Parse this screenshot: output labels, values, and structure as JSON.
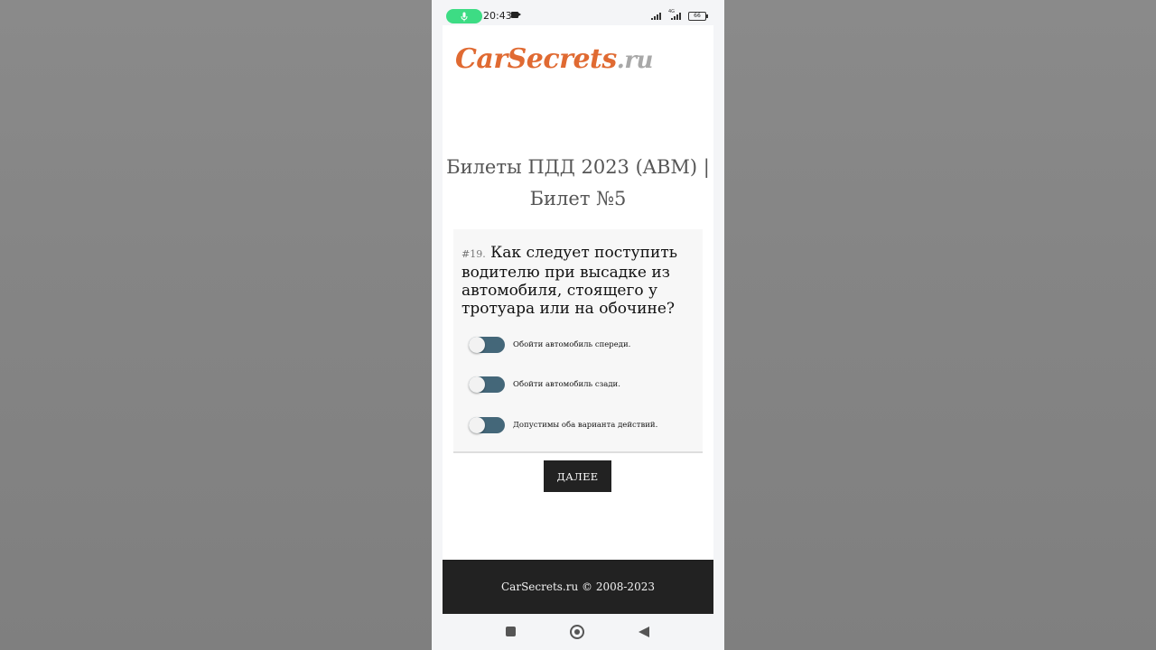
{
  "status_bar": {
    "time": "20:43",
    "network": "4G",
    "battery": "66"
  },
  "site": {
    "logo_main": "CarSecrets",
    "logo_tld": ".ru",
    "title_line1": "Билеты ПДД 2023 (ABM) |",
    "title_line2": "Билет №5"
  },
  "quiz": {
    "question_number": "#19.",
    "question_text": "Как следует поступить водителю при высадке из автомобиля, стоящего у тротуара или на обочине?",
    "options": [
      {
        "label": "Обойти автомобиль спереди.",
        "selected": false
      },
      {
        "label": "Обойти автомобиль сзади.",
        "selected": false
      },
      {
        "label": "Допустимы оба варианта действий.",
        "selected": false
      }
    ],
    "next_label": "ДАЛЕЕ"
  },
  "footer": {
    "text": "CarSecrets.ru © 2008-2023"
  },
  "icons": {
    "mic": "mic-icon",
    "camera": "video-record-icon",
    "signal": "signal-icon",
    "battery": "battery-icon",
    "recent": "recent-apps-icon",
    "home": "home-icon",
    "back": "back-icon"
  },
  "colors": {
    "logo_accent": "#e06a32",
    "logo_tld": "#a8a8a8",
    "toggle_track": "#446779",
    "button_bg": "#222222",
    "footer_bg": "#222222",
    "mic_pill": "#3ddc84"
  }
}
